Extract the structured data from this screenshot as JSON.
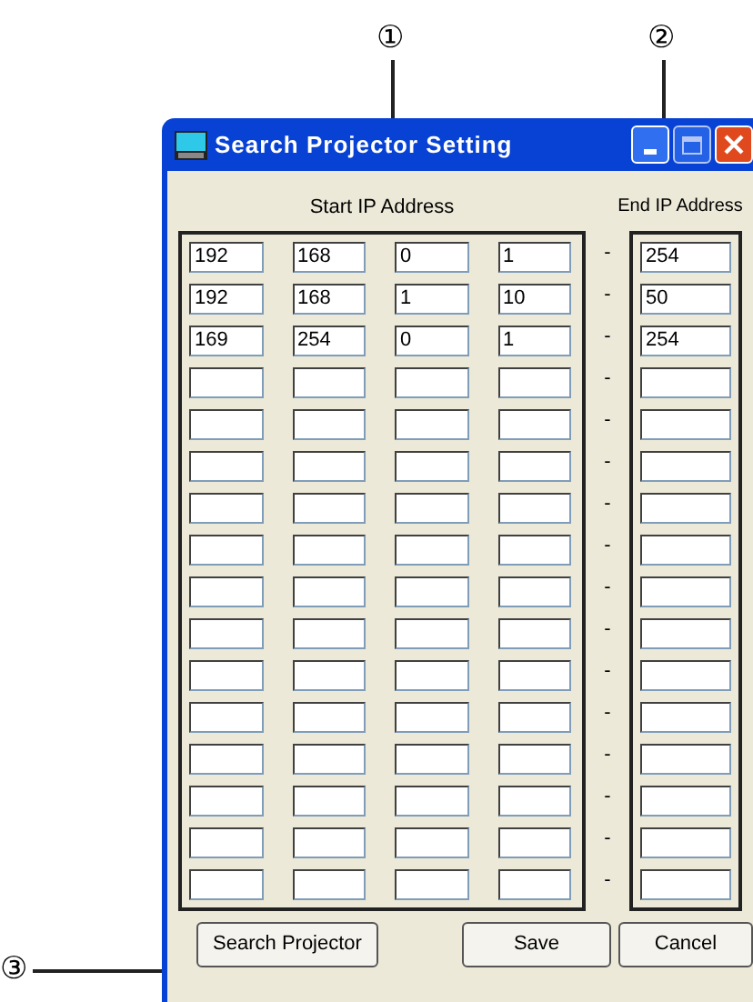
{
  "callouts": [
    {
      "label": "①"
    },
    {
      "label": "②"
    },
    {
      "label": "③"
    }
  ],
  "window": {
    "title": "Search Projector Setting"
  },
  "start_header": "Start IP Address",
  "end_header": "End IP Address",
  "rows": [
    {
      "kind": "filled",
      "start": [
        "192",
        "168",
        "0",
        "1"
      ],
      "separator": "-",
      "end": "254"
    },
    {
      "kind": "filled",
      "start": [
        "192",
        "168",
        "1",
        "10"
      ],
      "separator": "-",
      "end": "50"
    },
    {
      "kind": "filled",
      "start": [
        "169",
        "254",
        "0",
        "1"
      ],
      "separator": "-",
      "end": "254"
    },
    {
      "kind": "empty",
      "separator": "-"
    },
    {
      "kind": "empty",
      "separator": "-"
    },
    {
      "kind": "empty",
      "separator": "-"
    },
    {
      "kind": "empty",
      "separator": "-"
    },
    {
      "kind": "empty",
      "separator": "-"
    },
    {
      "kind": "empty",
      "separator": "-"
    },
    {
      "kind": "empty",
      "separator": "-"
    },
    {
      "kind": "empty",
      "separator": "-"
    },
    {
      "kind": "empty",
      "separator": "-"
    },
    {
      "kind": "empty",
      "separator": "-"
    },
    {
      "kind": "empty",
      "separator": "-"
    },
    {
      "kind": "empty",
      "separator": "-"
    },
    {
      "kind": "empty",
      "separator": "-"
    }
  ],
  "buttons": [
    "Search Projector",
    "Save",
    "Cancel"
  ]
}
